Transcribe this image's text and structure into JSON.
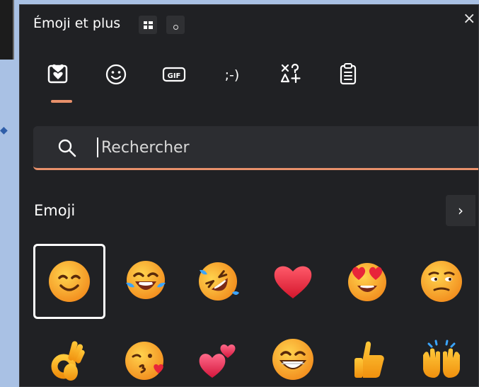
{
  "window": {
    "title": "Émoji et plus",
    "close_glyph": "×"
  },
  "tabs": [
    {
      "name": "favorites-tab",
      "icon": "heart-box-icon"
    },
    {
      "name": "emoji-tab",
      "icon": "smiley-icon"
    },
    {
      "name": "gif-tab",
      "icon": "gif-icon",
      "label": "GIF"
    },
    {
      "name": "kaomoji-tab",
      "icon": "kaomoji-icon",
      "label": ";-)"
    },
    {
      "name": "symbols-tab",
      "icon": "symbols-icon"
    },
    {
      "name": "clipboard-tab",
      "icon": "clipboard-icon"
    }
  ],
  "search": {
    "placeholder": "Rechercher",
    "value": ""
  },
  "section": {
    "label": "Emoji",
    "next_glyph": "›"
  },
  "emoji_grid": [
    {
      "char": "😊",
      "name": "smiling-face"
    },
    {
      "char": "😂",
      "name": "face-with-tears-of-joy"
    },
    {
      "char": "🤣",
      "name": "rolling-on-floor-laughing"
    },
    {
      "char": "❤️",
      "name": "red-heart"
    },
    {
      "char": "😍",
      "name": "heart-eyes"
    },
    {
      "char": "😒",
      "name": "unamused-face"
    },
    {
      "char": "👌",
      "name": "ok-hand"
    },
    {
      "char": "😘",
      "name": "face-blowing-kiss"
    },
    {
      "char": "💕",
      "name": "two-hearts"
    },
    {
      "char": "😁",
      "name": "beaming-face"
    },
    {
      "char": "👍",
      "name": "thumbs-up"
    },
    {
      "char": "🙌",
      "name": "raising-hands"
    }
  ],
  "colors": {
    "accent": "#e8906b",
    "panel": "#202124",
    "search_bg": "#2c2d31",
    "desktop": "#a9c1e4"
  }
}
